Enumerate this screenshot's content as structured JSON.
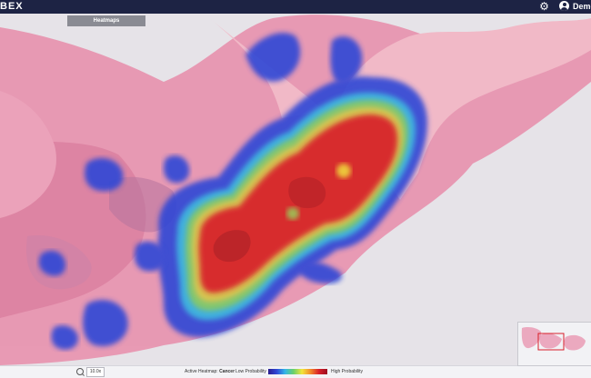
{
  "app": {
    "logo_text": "BEX"
  },
  "header": {
    "user_name": "Demo",
    "settings_icon": "gear-icon",
    "user_icon": "account-circle-icon"
  },
  "toolbar": {
    "heatmaps_label": "Heatmaps"
  },
  "footer": {
    "zoom_value": "10.0x",
    "active_heatmap_label": "Active Heatmap:",
    "active_heatmap_value": "Cancer",
    "low_label": "Low Probability",
    "high_label": "High Probability"
  },
  "colors": {
    "header_bg": "#1d2344",
    "tissue_pink": "#e58aa7",
    "heat_low": "#2f47d6",
    "heat_high": "#d81f2a"
  }
}
